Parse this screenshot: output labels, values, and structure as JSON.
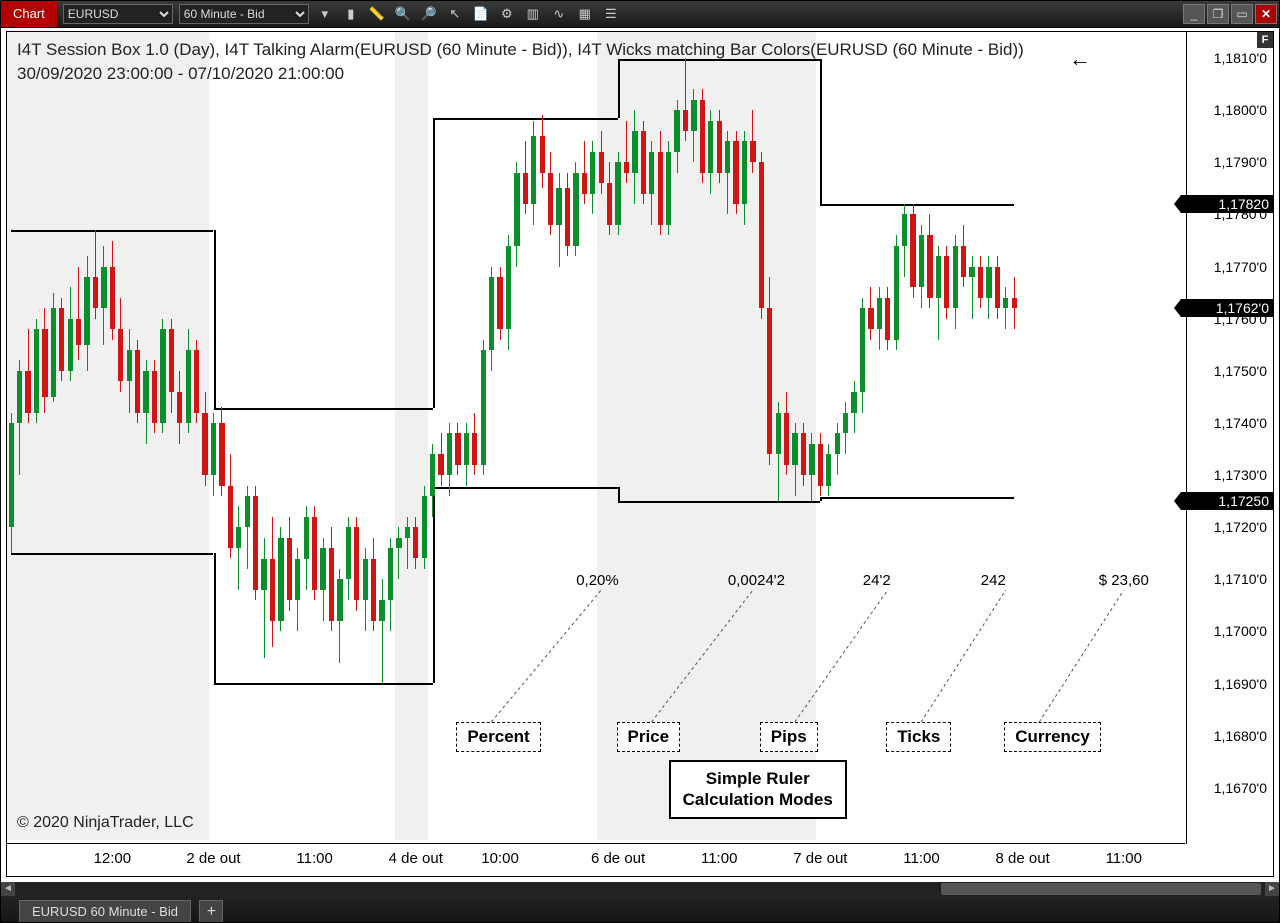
{
  "toolbar": {
    "tab_label": "Chart",
    "instrument": "EURUSD",
    "timeframe": "60 Minute - Bid",
    "icons": [
      "list",
      "chart",
      "ruler",
      "zoom-in",
      "zoom-out",
      "pointer",
      "doc",
      "tools",
      "candles",
      "path",
      "grid",
      "menu"
    ]
  },
  "window_buttons": {
    "min": "_",
    "max": "❐",
    "restore": "▭",
    "close": "✕"
  },
  "header": {
    "line1": "I4T Session Box 1.0 (Day), I4T Talking Alarm(EURUSD (60 Minute - Bid)), I4T Wicks matching Bar Colors(EURUSD (60 Minute - Bid))",
    "line2": "30/09/2020 23:00:00 - 07/10/2020 21:00:00"
  },
  "copyright": "© 2020 NinjaTrader, LLC",
  "f_button": "F",
  "back_arrow": "←",
  "y_axis": {
    "min": 1.166,
    "max": 1.1815,
    "ticks": [
      {
        "v": 1.181,
        "label": "1,1810'0"
      },
      {
        "v": 1.18,
        "label": "1,1800'0"
      },
      {
        "v": 1.179,
        "label": "1,1790'0"
      },
      {
        "v": 1.178,
        "label": "1,1780'0"
      },
      {
        "v": 1.177,
        "label": "1,1770'0"
      },
      {
        "v": 1.176,
        "label": "1,1760'0"
      },
      {
        "v": 1.175,
        "label": "1,1750'0"
      },
      {
        "v": 1.174,
        "label": "1,1740'0"
      },
      {
        "v": 1.173,
        "label": "1,1730'0"
      },
      {
        "v": 1.172,
        "label": "1,1720'0"
      },
      {
        "v": 1.171,
        "label": "1,1710'0"
      },
      {
        "v": 1.17,
        "label": "1,1700'0"
      },
      {
        "v": 1.169,
        "label": "1,1690'0"
      },
      {
        "v": 1.168,
        "label": "1,1680'0"
      },
      {
        "v": 1.167,
        "label": "1,1670'0"
      }
    ],
    "price_tags": [
      {
        "v": 1.1782,
        "label": "1,17820"
      },
      {
        "v": 1.1762,
        "label": "1,1762'0"
      },
      {
        "v": 1.1725,
        "label": "1,17250"
      }
    ]
  },
  "x_axis": {
    "ticks": [
      {
        "i": 12,
        "label": "12:00"
      },
      {
        "i": 24,
        "label": "2 de out"
      },
      {
        "i": 36,
        "label": "11:00"
      },
      {
        "i": 48,
        "label": "4 de out"
      },
      {
        "i": 58,
        "label": "10:00"
      },
      {
        "i": 72,
        "label": "6 de out"
      },
      {
        "i": 84,
        "label": "11:00"
      },
      {
        "i": 96,
        "label": "7 de out"
      },
      {
        "i": 108,
        "label": "11:00"
      },
      {
        "i": 120,
        "label": "8 de out"
      },
      {
        "i": 132,
        "label": "11:00"
      }
    ],
    "count": 140
  },
  "shaded_ranges": [
    {
      "from": 0,
      "to": 24
    },
    {
      "from": 46,
      "to": 50
    },
    {
      "from": 70,
      "to": 96
    }
  ],
  "session_boxes": [
    {
      "top": 1.1777,
      "bottom": 1.17151,
      "from": 0,
      "to": 24
    },
    {
      "top": 1.17428,
      "bottom": 1.16902,
      "from": 24,
      "to": 50
    },
    {
      "top": 1.17985,
      "bottom": 1.17278,
      "from": 50,
      "to": 72
    },
    {
      "top": 1.18098,
      "bottom": 1.1725,
      "from": 72,
      "to": 96
    },
    {
      "top": 1.1782,
      "bottom": 1.17258,
      "from": 96,
      "to": 119
    }
  ],
  "ruler_modes": {
    "title": "Simple Ruler\nCalculation Modes",
    "items": [
      {
        "label": "Percent",
        "value": "0,20%",
        "x_label": 54,
        "x_val": 70
      },
      {
        "label": "Price",
        "value": "0,0024'2",
        "x_label": 73,
        "x_val": 88
      },
      {
        "label": "Pips",
        "value": "24'2",
        "x_label": 90,
        "x_val": 104
      },
      {
        "label": "Ticks",
        "value": "242",
        "x_label": 105,
        "x_val": 118
      },
      {
        "label": "Currency",
        "value": "$ 23,60",
        "x_label": 119,
        "x_val": 132
      }
    ]
  },
  "bottom": {
    "tab": "EURUSD 60 Minute - Bid",
    "add": "+"
  },
  "chart_data": {
    "type": "candlestick",
    "instrument": "EURUSD",
    "interval": "60min",
    "ylim": [
      1.166,
      1.1815
    ],
    "series": [
      {
        "name": "EURUSD",
        "ohlc_ref": "candles"
      }
    ],
    "candles": [
      {
        "o": 1.172,
        "h": 1.1742,
        "l": 1.1715,
        "c": 1.174
      },
      {
        "o": 1.174,
        "h": 1.1752,
        "l": 1.173,
        "c": 1.175
      },
      {
        "o": 1.175,
        "h": 1.1758,
        "l": 1.174,
        "c": 1.1742
      },
      {
        "o": 1.1742,
        "h": 1.176,
        "l": 1.174,
        "c": 1.1758
      },
      {
        "o": 1.1758,
        "h": 1.1762,
        "l": 1.1742,
        "c": 1.1745
      },
      {
        "o": 1.1745,
        "h": 1.1765,
        "l": 1.1744,
        "c": 1.1762
      },
      {
        "o": 1.1762,
        "h": 1.1764,
        "l": 1.1748,
        "c": 1.175
      },
      {
        "o": 1.175,
        "h": 1.1766,
        "l": 1.1748,
        "c": 1.176
      },
      {
        "o": 1.176,
        "h": 1.177,
        "l": 1.1752,
        "c": 1.1755
      },
      {
        "o": 1.1755,
        "h": 1.1772,
        "l": 1.175,
        "c": 1.1768
      },
      {
        "o": 1.1768,
        "h": 1.1777,
        "l": 1.176,
        "c": 1.1762
      },
      {
        "o": 1.1762,
        "h": 1.1774,
        "l": 1.1755,
        "c": 1.177
      },
      {
        "o": 1.177,
        "h": 1.1775,
        "l": 1.1756,
        "c": 1.1758
      },
      {
        "o": 1.1758,
        "h": 1.1764,
        "l": 1.1746,
        "c": 1.1748
      },
      {
        "o": 1.1748,
        "h": 1.1758,
        "l": 1.1742,
        "c": 1.1754
      },
      {
        "o": 1.1754,
        "h": 1.1756,
        "l": 1.174,
        "c": 1.1742
      },
      {
        "o": 1.1742,
        "h": 1.1752,
        "l": 1.1736,
        "c": 1.175
      },
      {
        "o": 1.175,
        "h": 1.1752,
        "l": 1.1738,
        "c": 1.174
      },
      {
        "o": 1.174,
        "h": 1.176,
        "l": 1.1738,
        "c": 1.1758
      },
      {
        "o": 1.1758,
        "h": 1.176,
        "l": 1.1742,
        "c": 1.1746
      },
      {
        "o": 1.1746,
        "h": 1.175,
        "l": 1.1736,
        "c": 1.174
      },
      {
        "o": 1.174,
        "h": 1.1758,
        "l": 1.1738,
        "c": 1.1754
      },
      {
        "o": 1.1754,
        "h": 1.1756,
        "l": 1.174,
        "c": 1.1742
      },
      {
        "o": 1.1742,
        "h": 1.1746,
        "l": 1.1728,
        "c": 1.173
      },
      {
        "o": 1.173,
        "h": 1.1742,
        "l": 1.1726,
        "c": 1.174
      },
      {
        "o": 1.174,
        "h": 1.1743,
        "l": 1.1726,
        "c": 1.1728
      },
      {
        "o": 1.1728,
        "h": 1.1734,
        "l": 1.1714,
        "c": 1.1716
      },
      {
        "o": 1.1716,
        "h": 1.1724,
        "l": 1.1708,
        "c": 1.172
      },
      {
        "o": 1.172,
        "h": 1.1728,
        "l": 1.1712,
        "c": 1.1726
      },
      {
        "o": 1.1726,
        "h": 1.1728,
        "l": 1.1706,
        "c": 1.1708
      },
      {
        "o": 1.1708,
        "h": 1.1718,
        "l": 1.1695,
        "c": 1.1714
      },
      {
        "o": 1.1714,
        "h": 1.1722,
        "l": 1.1697,
        "c": 1.1702
      },
      {
        "o": 1.1702,
        "h": 1.172,
        "l": 1.17,
        "c": 1.1718
      },
      {
        "o": 1.1718,
        "h": 1.1722,
        "l": 1.1704,
        "c": 1.1706
      },
      {
        "o": 1.1706,
        "h": 1.1716,
        "l": 1.17,
        "c": 1.1714
      },
      {
        "o": 1.1714,
        "h": 1.1724,
        "l": 1.1708,
        "c": 1.1722
      },
      {
        "o": 1.1722,
        "h": 1.1724,
        "l": 1.1706,
        "c": 1.1708
      },
      {
        "o": 1.1708,
        "h": 1.1718,
        "l": 1.1702,
        "c": 1.1716
      },
      {
        "o": 1.1716,
        "h": 1.172,
        "l": 1.17,
        "c": 1.1702
      },
      {
        "o": 1.1702,
        "h": 1.1712,
        "l": 1.1694,
        "c": 1.171
      },
      {
        "o": 1.171,
        "h": 1.1722,
        "l": 1.1706,
        "c": 1.172
      },
      {
        "o": 1.172,
        "h": 1.1722,
        "l": 1.1704,
        "c": 1.1706
      },
      {
        "o": 1.1706,
        "h": 1.1716,
        "l": 1.17,
        "c": 1.1714
      },
      {
        "o": 1.1714,
        "h": 1.1718,
        "l": 1.17,
        "c": 1.1702
      },
      {
        "o": 1.1702,
        "h": 1.171,
        "l": 1.169,
        "c": 1.1706
      },
      {
        "o": 1.1706,
        "h": 1.1718,
        "l": 1.17,
        "c": 1.1716
      },
      {
        "o": 1.1716,
        "h": 1.172,
        "l": 1.171,
        "c": 1.1718
      },
      {
        "o": 1.1718,
        "h": 1.1722,
        "l": 1.1712,
        "c": 1.172
      },
      {
        "o": 1.172,
        "h": 1.1722,
        "l": 1.1712,
        "c": 1.1714
      },
      {
        "o": 1.1714,
        "h": 1.1728,
        "l": 1.1712,
        "c": 1.1726
      },
      {
        "o": 1.1726,
        "h": 1.1736,
        "l": 1.1722,
        "c": 1.1734
      },
      {
        "o": 1.1734,
        "h": 1.1738,
        "l": 1.1728,
        "c": 1.173
      },
      {
        "o": 1.173,
        "h": 1.174,
        "l": 1.1726,
        "c": 1.1738
      },
      {
        "o": 1.1738,
        "h": 1.174,
        "l": 1.173,
        "c": 1.1732
      },
      {
        "o": 1.1732,
        "h": 1.174,
        "l": 1.1728,
        "c": 1.1738
      },
      {
        "o": 1.1738,
        "h": 1.1742,
        "l": 1.173,
        "c": 1.1732
      },
      {
        "o": 1.1732,
        "h": 1.1756,
        "l": 1.173,
        "c": 1.1754
      },
      {
        "o": 1.1754,
        "h": 1.177,
        "l": 1.175,
        "c": 1.1768
      },
      {
        "o": 1.1768,
        "h": 1.177,
        "l": 1.1756,
        "c": 1.1758
      },
      {
        "o": 1.1758,
        "h": 1.1776,
        "l": 1.1754,
        "c": 1.1774
      },
      {
        "o": 1.1774,
        "h": 1.179,
        "l": 1.177,
        "c": 1.1788
      },
      {
        "o": 1.1788,
        "h": 1.1794,
        "l": 1.178,
        "c": 1.1782
      },
      {
        "o": 1.1782,
        "h": 1.1798,
        "l": 1.1778,
        "c": 1.1795
      },
      {
        "o": 1.1795,
        "h": 1.1799,
        "l": 1.1785,
        "c": 1.1788
      },
      {
        "o": 1.1788,
        "h": 1.1792,
        "l": 1.1776,
        "c": 1.1778
      },
      {
        "o": 1.1778,
        "h": 1.1788,
        "l": 1.177,
        "c": 1.1785
      },
      {
        "o": 1.1785,
        "h": 1.1788,
        "l": 1.1772,
        "c": 1.1774
      },
      {
        "o": 1.1774,
        "h": 1.179,
        "l": 1.1772,
        "c": 1.1788
      },
      {
        "o": 1.1788,
        "h": 1.1794,
        "l": 1.1782,
        "c": 1.1784
      },
      {
        "o": 1.1784,
        "h": 1.1794,
        "l": 1.178,
        "c": 1.1792
      },
      {
        "o": 1.1792,
        "h": 1.1796,
        "l": 1.1784,
        "c": 1.1786
      },
      {
        "o": 1.1786,
        "h": 1.179,
        "l": 1.1776,
        "c": 1.1778
      },
      {
        "o": 1.1778,
        "h": 1.1792,
        "l": 1.1776,
        "c": 1.179
      },
      {
        "o": 1.179,
        "h": 1.1798,
        "l": 1.1786,
        "c": 1.1788
      },
      {
        "o": 1.1788,
        "h": 1.18,
        "l": 1.1782,
        "c": 1.1796
      },
      {
        "o": 1.1796,
        "h": 1.1798,
        "l": 1.1782,
        "c": 1.1784
      },
      {
        "o": 1.1784,
        "h": 1.1794,
        "l": 1.1778,
        "c": 1.1792
      },
      {
        "o": 1.1792,
        "h": 1.1796,
        "l": 1.1776,
        "c": 1.1778
      },
      {
        "o": 1.1778,
        "h": 1.1794,
        "l": 1.1776,
        "c": 1.1792
      },
      {
        "o": 1.1792,
        "h": 1.1802,
        "l": 1.1788,
        "c": 1.18
      },
      {
        "o": 1.18,
        "h": 1.181,
        "l": 1.1794,
        "c": 1.1796
      },
      {
        "o": 1.1796,
        "h": 1.1804,
        "l": 1.179,
        "c": 1.1802
      },
      {
        "o": 1.1802,
        "h": 1.1804,
        "l": 1.1786,
        "c": 1.1788
      },
      {
        "o": 1.1788,
        "h": 1.18,
        "l": 1.1784,
        "c": 1.1798
      },
      {
        "o": 1.1798,
        "h": 1.18,
        "l": 1.1786,
        "c": 1.1788
      },
      {
        "o": 1.1788,
        "h": 1.1796,
        "l": 1.178,
        "c": 1.1794
      },
      {
        "o": 1.1794,
        "h": 1.1796,
        "l": 1.178,
        "c": 1.1782
      },
      {
        "o": 1.1782,
        "h": 1.1796,
        "l": 1.1778,
        "c": 1.1794
      },
      {
        "o": 1.1794,
        "h": 1.18,
        "l": 1.1788,
        "c": 1.179
      },
      {
        "o": 1.179,
        "h": 1.1792,
        "l": 1.176,
        "c": 1.1762
      },
      {
        "o": 1.1762,
        "h": 1.1768,
        "l": 1.1732,
        "c": 1.1734
      },
      {
        "o": 1.1734,
        "h": 1.1744,
        "l": 1.1725,
        "c": 1.1742
      },
      {
        "o": 1.1742,
        "h": 1.1746,
        "l": 1.173,
        "c": 1.1732
      },
      {
        "o": 1.1732,
        "h": 1.174,
        "l": 1.1726,
        "c": 1.1738
      },
      {
        "o": 1.1738,
        "h": 1.174,
        "l": 1.1728,
        "c": 1.173
      },
      {
        "o": 1.173,
        "h": 1.1738,
        "l": 1.1725,
        "c": 1.1736
      },
      {
        "o": 1.1736,
        "h": 1.1738,
        "l": 1.1726,
        "c": 1.1728
      },
      {
        "o": 1.1728,
        "h": 1.1736,
        "l": 1.1726,
        "c": 1.1734
      },
      {
        "o": 1.1734,
        "h": 1.174,
        "l": 1.173,
        "c": 1.1738
      },
      {
        "o": 1.1738,
        "h": 1.1744,
        "l": 1.1734,
        "c": 1.1742
      },
      {
        "o": 1.1742,
        "h": 1.1748,
        "l": 1.1738,
        "c": 1.1746
      },
      {
        "o": 1.1746,
        "h": 1.1764,
        "l": 1.1742,
        "c": 1.1762
      },
      {
        "o": 1.1762,
        "h": 1.1766,
        "l": 1.1756,
        "c": 1.1758
      },
      {
        "o": 1.1758,
        "h": 1.1766,
        "l": 1.1754,
        "c": 1.1764
      },
      {
        "o": 1.1764,
        "h": 1.1766,
        "l": 1.1754,
        "c": 1.1756
      },
      {
        "o": 1.1756,
        "h": 1.1776,
        "l": 1.1754,
        "c": 1.1774
      },
      {
        "o": 1.1774,
        "h": 1.1782,
        "l": 1.1768,
        "c": 1.178
      },
      {
        "o": 1.178,
        "h": 1.1782,
        "l": 1.1764,
        "c": 1.1766
      },
      {
        "o": 1.1766,
        "h": 1.1778,
        "l": 1.1762,
        "c": 1.1776
      },
      {
        "o": 1.1776,
        "h": 1.178,
        "l": 1.1762,
        "c": 1.1764
      },
      {
        "o": 1.1764,
        "h": 1.1774,
        "l": 1.1756,
        "c": 1.1772
      },
      {
        "o": 1.1772,
        "h": 1.1774,
        "l": 1.176,
        "c": 1.1762
      },
      {
        "o": 1.1762,
        "h": 1.1776,
        "l": 1.1758,
        "c": 1.1774
      },
      {
        "o": 1.1774,
        "h": 1.1778,
        "l": 1.1766,
        "c": 1.1768
      },
      {
        "o": 1.1768,
        "h": 1.1772,
        "l": 1.176,
        "c": 1.177
      },
      {
        "o": 1.177,
        "h": 1.1772,
        "l": 1.1762,
        "c": 1.1764
      },
      {
        "o": 1.1764,
        "h": 1.1772,
        "l": 1.176,
        "c": 1.177
      },
      {
        "o": 1.177,
        "h": 1.1772,
        "l": 1.176,
        "c": 1.1762
      },
      {
        "o": 1.1762,
        "h": 1.1766,
        "l": 1.1758,
        "c": 1.1764
      },
      {
        "o": 1.1764,
        "h": 1.1768,
        "l": 1.1758,
        "c": 1.1762
      }
    ]
  }
}
